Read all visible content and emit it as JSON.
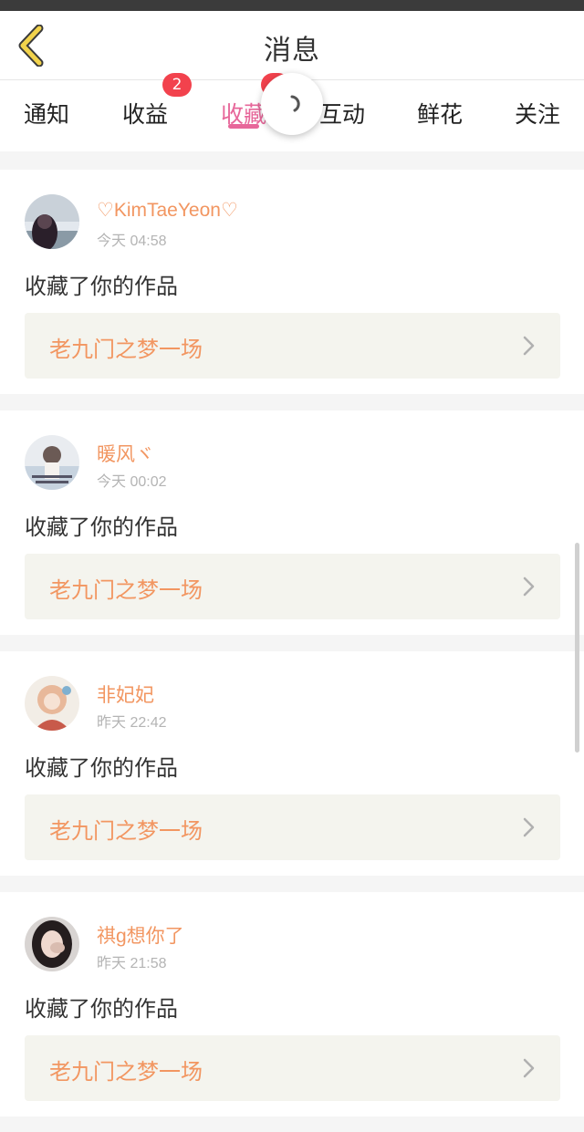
{
  "header": {
    "title": "消息",
    "back_icon": "chevron-left-icon",
    "accent_color": "#f2d34c"
  },
  "tabs": [
    {
      "label": "通知",
      "badge": ""
    },
    {
      "label": "收益",
      "badge": "2"
    },
    {
      "label": "收藏",
      "badge": "",
      "active": true
    },
    {
      "label": "互动",
      "badge": ""
    },
    {
      "label": "鲜花",
      "badge": ""
    },
    {
      "label": "关注",
      "badge": ""
    }
  ],
  "active_tab_color": "#e7679a",
  "items": [
    {
      "username": "♡KimTaeYeon♡",
      "time": "今天 04:58",
      "action": "收藏了你的作品",
      "work": "老九门之梦一场"
    },
    {
      "username": "暖风ヾ",
      "time": "今天 00:02",
      "action": "收藏了你的作品",
      "work": "老九门之梦一场"
    },
    {
      "username": "非妃妃",
      "time": "昨天 22:42",
      "action": "收藏了你的作品",
      "work": "老九门之梦一场"
    },
    {
      "username": "祺g想你了",
      "time": "昨天 21:58",
      "action": "收藏了你的作品",
      "work": "老九门之梦一场"
    }
  ]
}
